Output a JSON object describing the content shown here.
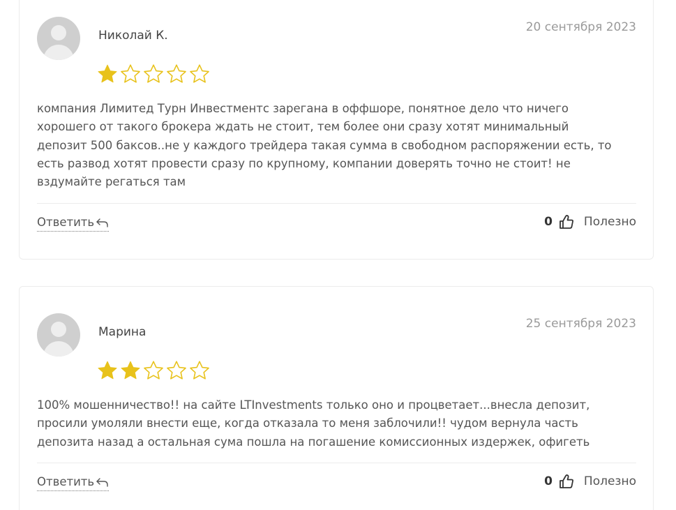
{
  "reviews": [
    {
      "author": "Николай К.",
      "date": "20 сентября 2023",
      "rating": 1,
      "max_rating": 5,
      "text": "компания Лимитед Турн Инвестментс зарегана в оффшоре, понятное дело что ничего\nхорошего от такого брокера ждать не стоит, тем более они сразу хотят минимальный\nдепозит 500 баксов..не у каждого трейдера такая сумма в свободном распоряжении есть, то\nесть развод хотят провести сразу по крупному, компании доверять точно не стоит! не\nвздумайте регаться там",
      "reply_label": "Ответить",
      "helpful_count": "0",
      "helpful_label": "Полезно"
    },
    {
      "author": "Марина",
      "date": "25 сентября 2023",
      "rating": 2,
      "max_rating": 5,
      "text": "100% мошенничество!! на сайте LTInvestments только оно и процветает...внесла депозит,\nпросили умоляли внести еще, когда отказала то меня заблочили!! чудом вернула часть\nдепозита назад а остальная сума пошла на погашение комиссионных издержек, офигеть",
      "reply_label": "Ответить",
      "helpful_count": "0",
      "helpful_label": "Полезно"
    }
  ],
  "colors": {
    "star_filled": "#E8C21B",
    "star_outline": "#E8C21B",
    "border": "#ECECEC",
    "date": "#9A9A9A",
    "text": "#555555"
  },
  "icons": {
    "avatar": "user-silhouette-icon",
    "star": "star-icon",
    "reply": "reply-arrow-icon",
    "helpful": "thumbs-up-icon"
  }
}
